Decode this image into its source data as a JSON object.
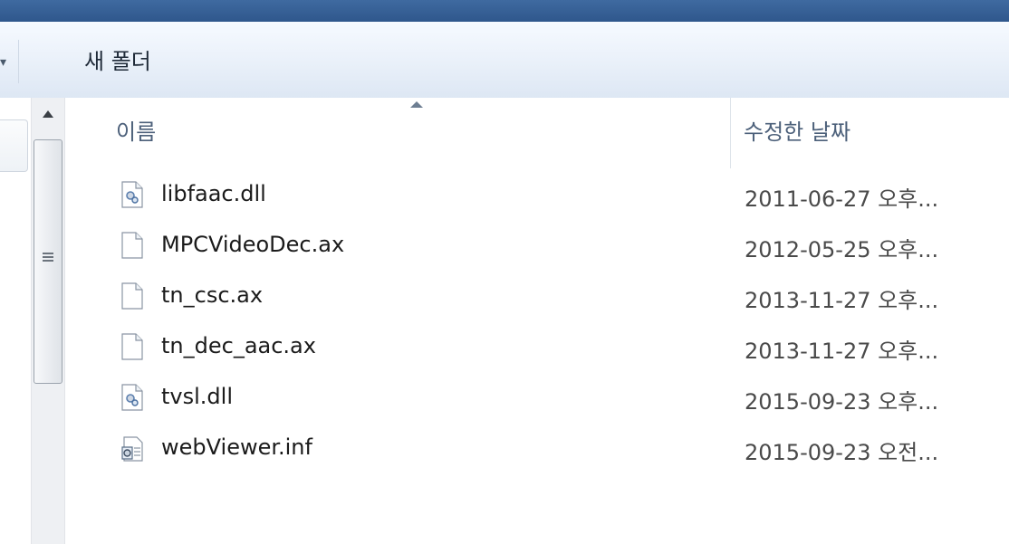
{
  "toolbar": {
    "new_folder_label": "새 폴더",
    "dropdown_glyph": "▾"
  },
  "columns": {
    "name": "이름",
    "modified": "수정한 날짜"
  },
  "files": [
    {
      "name": "libfaac.dll",
      "modified": "2011-06-27 오후...",
      "icon": "dll-gear-file-icon"
    },
    {
      "name": "MPCVideoDec.ax",
      "modified": "2012-05-25 오후...",
      "icon": "blank-file-icon"
    },
    {
      "name": "tn_csc.ax",
      "modified": "2013-11-27 오후...",
      "icon": "blank-file-icon"
    },
    {
      "name": "tn_dec_aac.ax",
      "modified": "2013-11-27 오후...",
      "icon": "blank-file-icon"
    },
    {
      "name": "tvsl.dll",
      "modified": "2015-09-23 오후...",
      "icon": "dll-gear-file-icon"
    },
    {
      "name": "webViewer.inf",
      "modified": "2015-09-23 오전...",
      "icon": "setup-info-file-icon"
    }
  ],
  "colors": {
    "title_bar": "#2f578c",
    "header_text": "#4c607a",
    "toolbar_bg": "#e9f0f9"
  }
}
